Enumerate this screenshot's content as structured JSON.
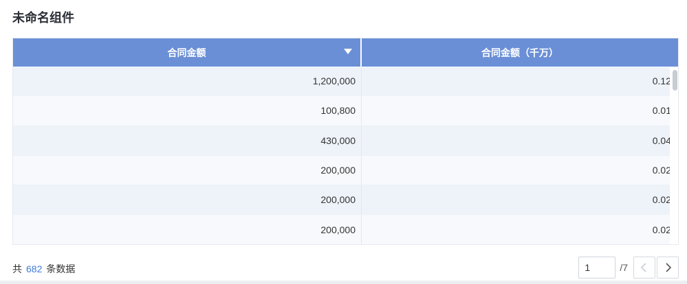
{
  "widget": {
    "title": "未命名组件"
  },
  "table": {
    "columns": [
      "合同金额",
      "合同金额（千万）"
    ],
    "rows": [
      [
        "1,200,000",
        "0.12"
      ],
      [
        "100,800",
        "0.01"
      ],
      [
        "430,000",
        "0.04"
      ],
      [
        "200,000",
        "0.02"
      ],
      [
        "200,000",
        "0.02"
      ],
      [
        "200,000",
        "0.02"
      ]
    ]
  },
  "footer": {
    "total_prefix": "共",
    "total_count": "682",
    "total_suffix": "条数据",
    "page_input_value": "1",
    "total_pages": "/7"
  },
  "colors": {
    "header_bg": "#6a8fd6",
    "row_alt_bg": "#eef3fa",
    "accent": "#3f7ad8"
  },
  "icons": {
    "sort": "caret-down-icon",
    "prev": "chevron-left-icon",
    "next": "chevron-right-icon"
  }
}
